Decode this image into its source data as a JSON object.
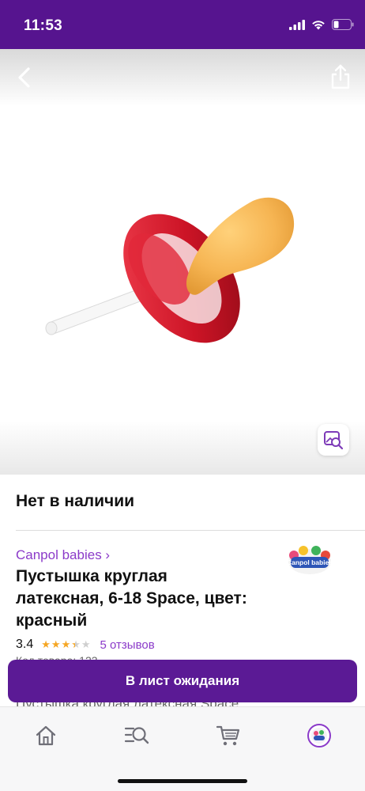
{
  "status_bar": {
    "time": "11:53",
    "icons": [
      "signal-icon",
      "wifi-icon",
      "battery-icon"
    ],
    "background": "#56148f"
  },
  "hero": {
    "icons": [
      "back-arrow-icon",
      "share-icon",
      "visual-search-icon"
    ],
    "product_image": "red-latex-pacifier"
  },
  "product": {
    "stock_status": "Нет в наличии",
    "brand": "Canpol babies ›",
    "brand_logo_text": "Canpol babies",
    "title": "Пустышка круглая латексная, 6-18 Space, цвет: красный",
    "rating": "3.4",
    "rating_value": 3.4,
    "rating_max": 5,
    "reviews": "5 отзывов"
  },
  "partially_hidden": {
    "line1": "Код товара: 123",
    "line2": "Пустышка круглая латексная Space"
  },
  "actions": {
    "waitlist_label": "В лист ожидания"
  },
  "tab_bar": {
    "tabs": [
      "home-icon",
      "catalog-search-icon",
      "cart-icon",
      "profile-avatar"
    ]
  },
  "colors": {
    "accent": "#5b1a95",
    "link": "#8b3ac9",
    "star": "#f5a623"
  }
}
